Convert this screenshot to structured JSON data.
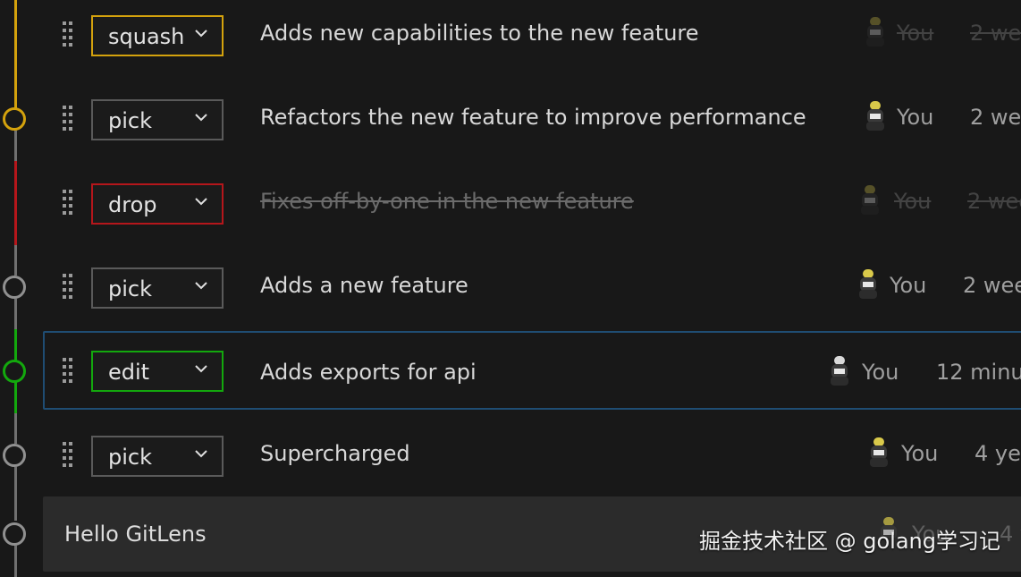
{
  "colors": {
    "squash": "#d4a20d",
    "drop": "#b5161b",
    "edit": "#13a80d",
    "pick_border": "#5a5a5a",
    "focus": "#1f4d73",
    "default_node": "#909090"
  },
  "rows": [
    {
      "action": "squash",
      "message": "Adds new capabilities to the new feature",
      "author": "You",
      "date": "2 wee",
      "avatar": "user-avatar-icon"
    },
    {
      "action": "pick",
      "message": "Refactors the new feature to improve performance",
      "author": "You",
      "date": "2 wee",
      "avatar": "user-avatar-icon"
    },
    {
      "action": "drop",
      "message": "Fixes off-by-one in the new feature",
      "author": "You",
      "date": "2 wee",
      "avatar": "user-avatar-icon"
    },
    {
      "action": "pick",
      "message": "Adds a new feature",
      "author": "You",
      "date": "2 wee",
      "avatar": "user-avatar-icon"
    },
    {
      "action": "edit",
      "message": "Adds exports for api",
      "author": "You",
      "date": "12 minu",
      "avatar": "user-avatar-icon"
    },
    {
      "action": "pick",
      "message": "Supercharged",
      "author": "You",
      "date": "4 yea",
      "avatar": "user-avatar-icon"
    }
  ],
  "base": {
    "title": "Hello GitLens",
    "author": "You",
    "date": "4 ye"
  },
  "watermark": "掘金技术社区 @ golang学习记"
}
